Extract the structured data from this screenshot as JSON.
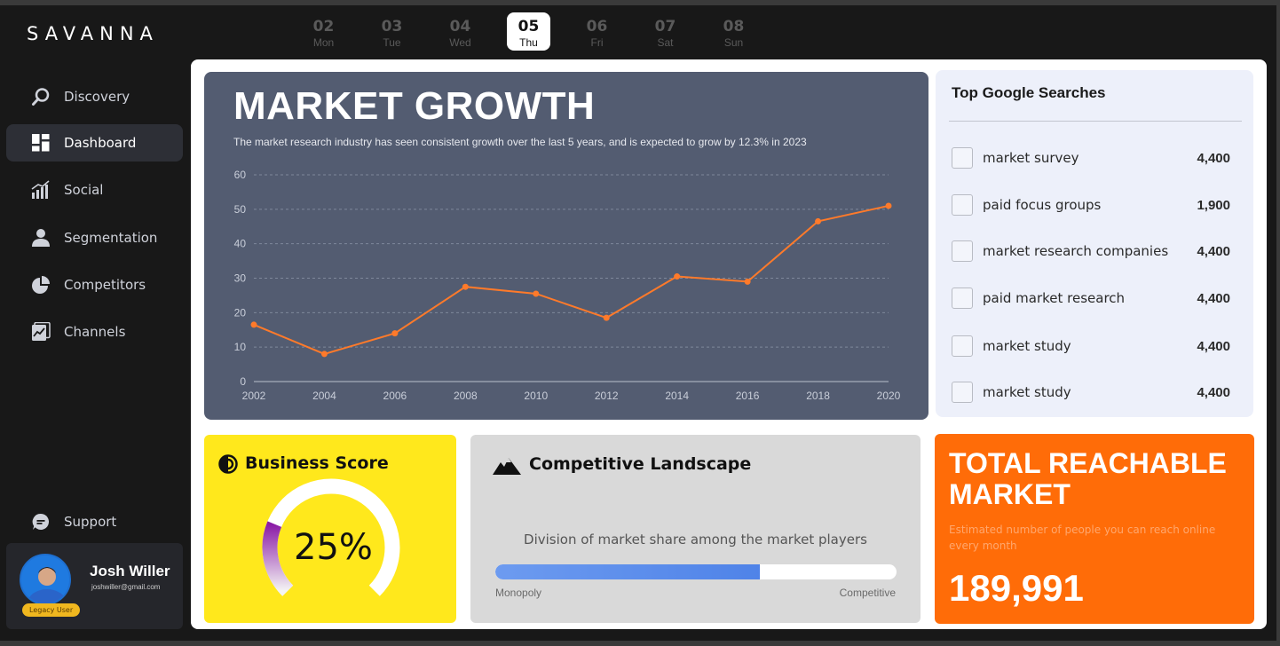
{
  "app": {
    "logo": "SAVANNA"
  },
  "days": [
    {
      "num": "02",
      "name": "Mon",
      "active": false
    },
    {
      "num": "03",
      "name": "Tue",
      "active": false
    },
    {
      "num": "04",
      "name": "Wed",
      "active": false
    },
    {
      "num": "05",
      "name": "Thu",
      "active": true
    },
    {
      "num": "06",
      "name": "Fri",
      "active": false
    },
    {
      "num": "07",
      "name": "Sat",
      "active": false
    },
    {
      "num": "08",
      "name": "Sun",
      "active": false
    }
  ],
  "sidebar": {
    "items": [
      {
        "label": "Discovery",
        "icon": "search-icon"
      },
      {
        "label": "Dashboard",
        "icon": "dashboard-icon",
        "active": true
      },
      {
        "label": "Social",
        "icon": "bar-chart-icon"
      },
      {
        "label": "Segmentation",
        "icon": "user-icon"
      },
      {
        "label": "Competitors",
        "icon": "pie-chart-icon"
      },
      {
        "label": "Channels",
        "icon": "channels-icon"
      }
    ],
    "support": {
      "label": "Support",
      "icon": "chat-icon"
    }
  },
  "user": {
    "name": "Josh Willer",
    "email": "joshwiller@gmail.com",
    "badge": "Legacy User"
  },
  "growth": {
    "title": "MARKET GROWTH",
    "subtitle": "The market research industry has seen consistent growth over the last 5 years, and is expected to grow by 12.3% in 2023"
  },
  "chart_data": {
    "type": "line",
    "title": "MARKET GROWTH",
    "x": [
      2002,
      2004,
      2006,
      2008,
      2010,
      2012,
      2014,
      2016,
      2018,
      2020
    ],
    "x_ticks": [
      "2002",
      "2004",
      "2006",
      "2008",
      "2010",
      "2012",
      "2014",
      "2016",
      "2018",
      "2020"
    ],
    "y_ticks": [
      "0",
      "10",
      "20",
      "30",
      "40",
      "50",
      "60"
    ],
    "series": [
      {
        "values": [
          16.5,
          8,
          14,
          27.5,
          25.5,
          18.5,
          30.5,
          29,
          46.5,
          51
        ]
      }
    ],
    "ylim": [
      0,
      60
    ],
    "xlim": [
      2002,
      2020
    ],
    "grid": true,
    "color": "#ff7a2a"
  },
  "searches": {
    "title": "Top Google Searches",
    "rows": [
      {
        "term": "market survey",
        "count": "4,400"
      },
      {
        "term": "paid focus groups",
        "count": "1,900"
      },
      {
        "term": "market research companies",
        "count": "4,400"
      },
      {
        "term": "paid market research",
        "count": "4,400"
      },
      {
        "term": "market study",
        "count": "4,400"
      },
      {
        "term": "market study",
        "count": "4,400"
      }
    ]
  },
  "business": {
    "title": "Business Score",
    "score": "25%",
    "score_value": 0.25
  },
  "competitive": {
    "title": "Competitive Landscape",
    "subtitle": "Division of market share among the market players",
    "left_label": "Monopoly",
    "right_label": "Competitive",
    "fill_percent": 66
  },
  "trm": {
    "title": "TOTAL REACHABLE MARKET",
    "subtitle": "Estimated number of people you can reach online every month",
    "value": "189,991"
  },
  "colors": {
    "accent_orange": "#ff6c08",
    "yellow": "#ffe81c",
    "chart_bg": "#535c71",
    "line": "#ff7a2a"
  }
}
